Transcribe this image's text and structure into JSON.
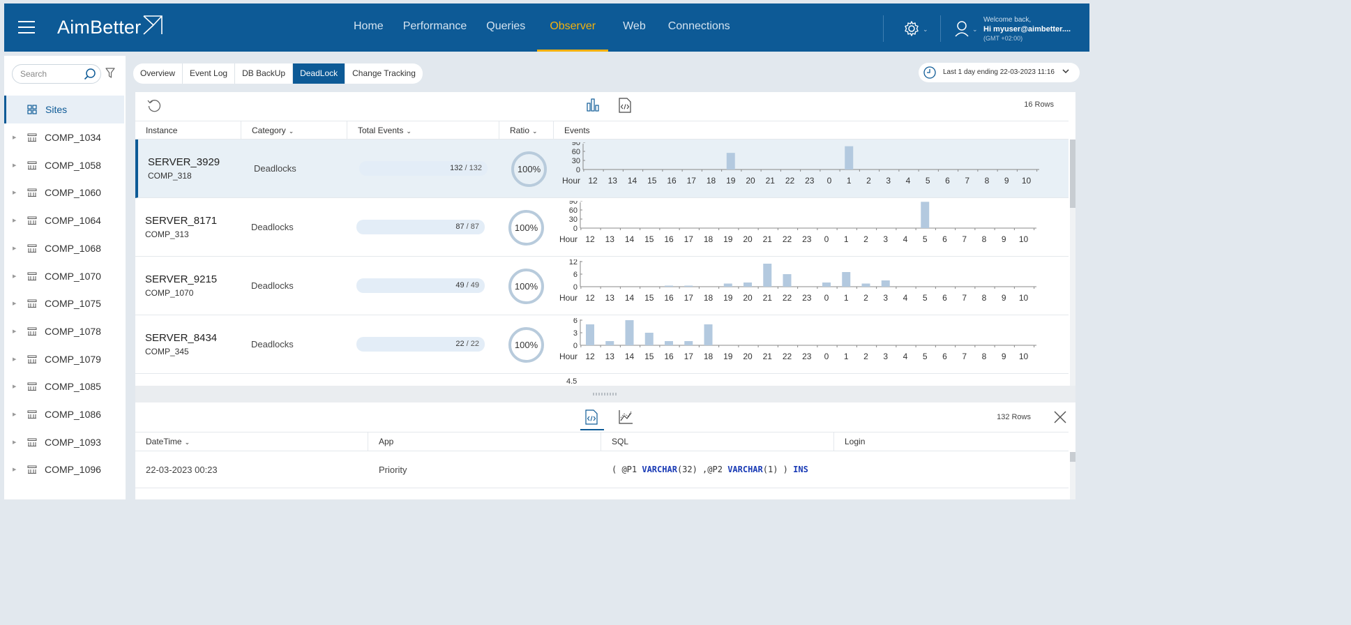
{
  "app": {
    "logo": "AimBetter"
  },
  "nav": {
    "items": [
      "Home",
      "Performance",
      "Queries",
      "Observer",
      "Web",
      "Connections"
    ],
    "active": "Observer"
  },
  "user": {
    "welcome": "Welcome back,",
    "name": "Hi myuser@aimbetter....",
    "tz": "(GMT +02:00)"
  },
  "sidebar": {
    "search_placeholder": "Search",
    "sites_label": "Sites",
    "items": [
      "COMP_1034",
      "COMP_1058",
      "COMP_1060",
      "COMP_1064",
      "COMP_1068",
      "COMP_1070",
      "COMP_1075",
      "COMP_1078",
      "COMP_1079",
      "COMP_1085",
      "COMP_1086",
      "COMP_1093",
      "COMP_1096"
    ]
  },
  "tabs": {
    "items": [
      "Overview",
      "Event Log",
      "DB BackUp",
      "DeadLock",
      "Change Tracking"
    ],
    "active": "DeadLock"
  },
  "daterange": {
    "label": "Last 1 day ending",
    "value": "22-03-2023 11:16"
  },
  "table": {
    "rows_label": "16 Rows",
    "headers": {
      "instance": "Instance",
      "category": "Category",
      "total": "Total Events",
      "ratio": "Ratio",
      "events": "Events"
    },
    "hour_label": "Hour",
    "hours": [
      "12",
      "13",
      "14",
      "15",
      "16",
      "17",
      "18",
      "19",
      "20",
      "21",
      "22",
      "23",
      "0",
      "1",
      "2",
      "3",
      "4",
      "5",
      "6",
      "7",
      "8",
      "9",
      "10",
      "11"
    ],
    "rows": [
      {
        "server": "SERVER_3929",
        "comp": "COMP_318",
        "category": "Deadlocks",
        "events": "132",
        "total": "132",
        "ratio": "100%",
        "ticks": [
          "90",
          "60",
          "30",
          "0"
        ],
        "max": 90,
        "counts": [
          0,
          0,
          0,
          0,
          0,
          0,
          0,
          55,
          0,
          0,
          0,
          0,
          0,
          77,
          0,
          0,
          0,
          0,
          0,
          0,
          0,
          0,
          0,
          0
        ]
      },
      {
        "server": "SERVER_8171",
        "comp": "COMP_313",
        "category": "Deadlocks",
        "events": "87",
        "total": "87",
        "ratio": "100%",
        "ticks": [
          "90",
          "60",
          "30",
          "0"
        ],
        "max": 90,
        "counts": [
          0,
          0,
          0,
          0,
          0,
          0,
          0,
          0,
          0,
          0,
          0,
          0,
          0,
          0,
          0,
          0,
          0,
          87,
          0,
          0,
          0,
          0,
          0,
          0
        ]
      },
      {
        "server": "SERVER_9215",
        "comp": "COMP_1070",
        "category": "Deadlocks",
        "events": "49",
        "total": "49",
        "ratio": "100%",
        "ticks": [
          "12",
          "6",
          "0"
        ],
        "max": 13,
        "counts": [
          0,
          0,
          0,
          0,
          0.5,
          0.5,
          0,
          1.5,
          2,
          11,
          6,
          0,
          2,
          7,
          1.5,
          3,
          0,
          0,
          0,
          0,
          0,
          0,
          0,
          0
        ]
      },
      {
        "server": "SERVER_8434",
        "comp": "COMP_345",
        "category": "Deadlocks",
        "events": "22",
        "total": "22",
        "ratio": "100%",
        "ticks": [
          "6",
          "3",
          "0"
        ],
        "max": 6.5,
        "counts": [
          5,
          1,
          6,
          3,
          1,
          1,
          5,
          0,
          0,
          0,
          0,
          0,
          0,
          0,
          0,
          0,
          0,
          0,
          0,
          0,
          0,
          0,
          0,
          0
        ]
      }
    ],
    "partial_tick": "4.5"
  },
  "bottom": {
    "rows_label": "132 Rows",
    "headers": {
      "datetime": "DateTime",
      "app": "App",
      "sql": "SQL",
      "login": "Login"
    },
    "row": {
      "datetime": "22-03-2023 00:23",
      "app": "Priority",
      "sql": {
        "p1": "( @P1 ",
        "t1": "VARCHAR",
        "p2": "(32) ,@P2 ",
        "t2": "VARCHAR",
        "p3": "(1) ) ",
        "kw": "INS"
      },
      "login": ""
    }
  },
  "colors": {
    "brand": "#0d5a96",
    "accent": "#f2b10e",
    "bar": "#b3c9df"
  }
}
